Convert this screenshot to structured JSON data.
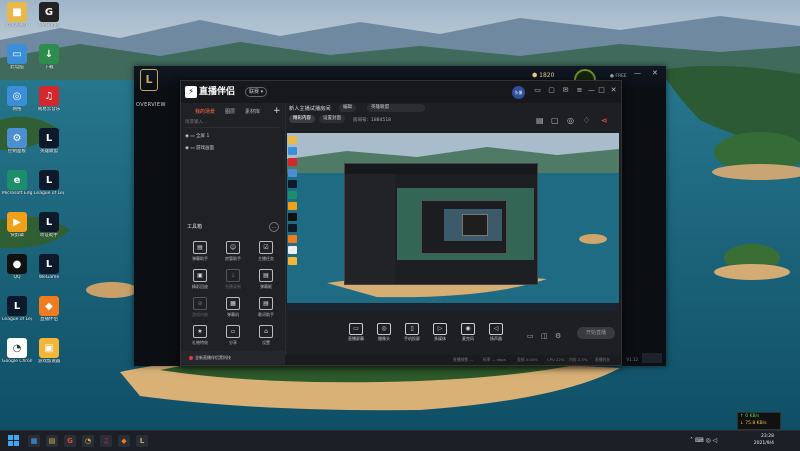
{
  "desktop": {
    "icons": [
      {
        "label": "IronyDesk",
        "color": "#e8b84a",
        "glyph": "■"
      },
      {
        "label": "WeGame",
        "color": "#222",
        "glyph": "G"
      },
      {
        "label": "此电脑",
        "color": "#3a8fd8",
        "glyph": "▭"
      },
      {
        "label": "下载",
        "color": "#2f8c4f",
        "glyph": "↓"
      },
      {
        "label": "网络",
        "color": "#3a8fd8",
        "glyph": "◎"
      },
      {
        "label": "网易云音乐",
        "color": "#d2282e",
        "glyph": "♫"
      },
      {
        "label": "控制面板",
        "color": "#4b8fd1",
        "glyph": "⚙"
      },
      {
        "label": "英雄联盟",
        "color": "#0d1a2b",
        "glyph": "L"
      },
      {
        "label": "Microsoft Edge",
        "color": "#1a8f6a",
        "glyph": "e"
      },
      {
        "label": "League of Legends",
        "color": "#0d1a2b",
        "glyph": "L"
      },
      {
        "label": "快剪辑",
        "color": "#f0a019",
        "glyph": "▶"
      },
      {
        "label": "听证助手",
        "color": "#0d1a2b",
        "glyph": "L"
      },
      {
        "label": "QQ",
        "color": "#111",
        "glyph": "●"
      },
      {
        "label": "WeGame",
        "color": "#0d1a2b",
        "glyph": "L"
      },
      {
        "label": "League of Legends",
        "color": "#0d1a2b",
        "glyph": "L"
      },
      {
        "label": "直播伴侣",
        "color": "#f07c22",
        "glyph": "◆"
      },
      {
        "label": "Google Chrome",
        "color": "#fff",
        "glyph": "◔"
      },
      {
        "label": "游戏加速器",
        "color": "#f3b63a",
        "glyph": "▣"
      }
    ]
  },
  "game_client": {
    "logo": "L",
    "subtitle": "OVERVIEW",
    "coins": "1820",
    "stat_line": "● FREE",
    "controls": [
      "—",
      "✕"
    ],
    "version": "V1.12"
  },
  "app": {
    "logo_text": "直播伴侣",
    "logo_mark": "⚡",
    "badge": "联赛 ▾",
    "avatar": "头像",
    "header_icons": [
      "▭",
      "▢",
      "✉",
      "≡",
      "—",
      "□",
      "✕"
    ],
    "tabs": [
      "我的场景",
      "图层",
      "素材库"
    ],
    "add_scene": "+",
    "scene_input_placeholder": "场景输入...",
    "scenes": [
      "全屏 1",
      "游戏画面"
    ],
    "toolbox_title": "工具箱",
    "toolbox_more": "…",
    "tools": [
      {
        "label": "弹幕助手",
        "icon": "▤",
        "dim": false
      },
      {
        "label": "房管助手",
        "icon": "☺",
        "dim": false
      },
      {
        "label": "主播任务",
        "icon": "☑",
        "dim": false
      },
      {
        "label": "精彩回放",
        "icon": "▣",
        "dim": false
      },
      {
        "label": "直播录制",
        "icon": "↓",
        "dim": true
      },
      {
        "label": "弹幕姬",
        "icon": "▤",
        "dim": false
      },
      {
        "label": "游戏内嵌",
        "icon": "⊕",
        "dim": true
      },
      {
        "label": "弹幕机",
        "icon": "▦",
        "dim": false
      },
      {
        "label": "歌词助手",
        "icon": "▤",
        "dim": false
      },
      {
        "label": "礼物特效",
        "icon": "★",
        "dim": false
      },
      {
        "label": "分享",
        "icon": "▫",
        "dim": false
      },
      {
        "label": "设置",
        "icon": "⌂",
        "dim": false
      }
    ],
    "notice": "全新直播伴侣黑科技",
    "room_title": "新人主播试播房间",
    "room_tag": "编辑",
    "room_category": "英雄联盟",
    "pills": [
      "精彩内容",
      "设置封面"
    ],
    "room_id_label": "房间号：1884518",
    "controls": [
      {
        "label": "直播屏幕",
        "icon": "▭"
      },
      {
        "label": "摄像头",
        "icon": "◎"
      },
      {
        "label": "手机投屏",
        "icon": "▯"
      },
      {
        "label": "多媒体",
        "icon": "▷"
      },
      {
        "label": "麦克风",
        "icon": "◉"
      },
      {
        "label": "扬声器",
        "icon": "◁"
      }
    ],
    "go_live": "开始直播",
    "status": {
      "fps": "直播帧数 —",
      "bitrate": "码率 — kbps",
      "drop": "丢帧 0.00%",
      "cpu": "CPU 22%",
      "mem": "内存 2.3%",
      "live_time": "直播时长"
    }
  },
  "taskbar": {
    "apps": [
      {
        "glyph": "▦",
        "color": "#3fa9f5"
      },
      {
        "glyph": "▤",
        "color": "#e8b84a"
      },
      {
        "glyph": "G",
        "color": "#e24a2b"
      },
      {
        "glyph": "◔",
        "color": "#e2b42a"
      },
      {
        "glyph": "♫",
        "color": "#d2282e"
      },
      {
        "glyph": "◆",
        "color": "#f07c22"
      },
      {
        "glyph": "L",
        "color": "#c8a75a"
      }
    ],
    "tray": "˄  ⌨  ◎  ◁",
    "time": "23:28",
    "date": "2021/9/4",
    "net_up": "↑ 0 KB/s",
    "net_down": "↓ 75.8 KB/s"
  },
  "colors": {
    "accent": "#e53935",
    "app_bg": "#1e1f23",
    "taskbar": "#1c2026"
  }
}
